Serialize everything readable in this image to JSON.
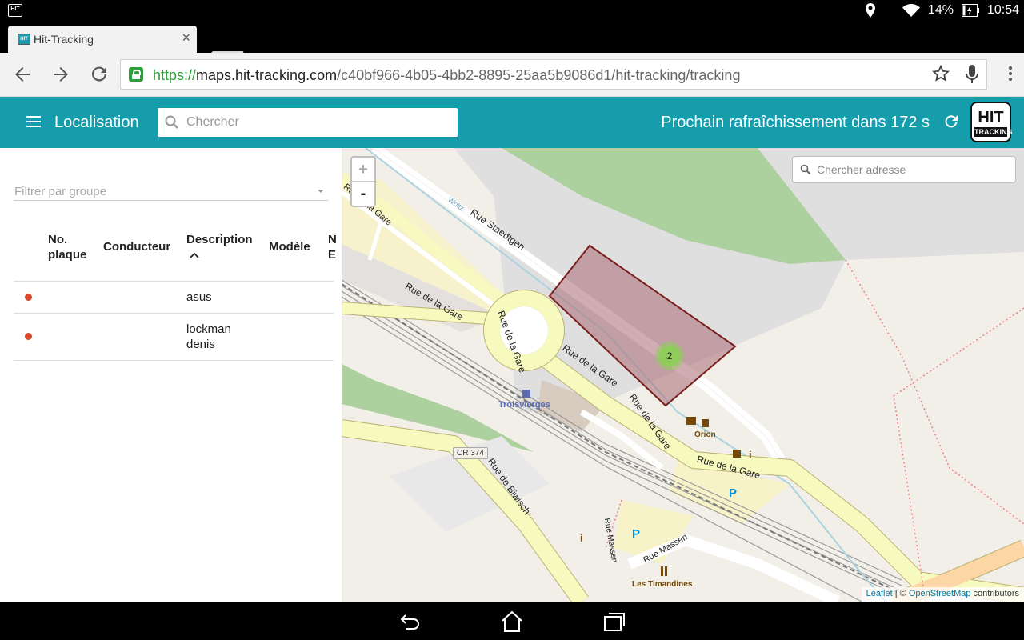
{
  "statusbar": {
    "battery": "14%",
    "time": "10:54",
    "app_icon_text": "HIT"
  },
  "tab": {
    "title": "Hit-Tracking",
    "close": "×"
  },
  "browser": {
    "url_scheme": "https://",
    "url_host": "maps.hit-tracking.com",
    "url_path": "/c40bf966-4b05-4bb2-8895-25aa5b9086d1/hit-tracking/tracking"
  },
  "appbar": {
    "title": "Localisation",
    "search_placeholder": "Chercher",
    "refresh_text": "Prochain rafraîchissement dans 172 s",
    "logo_line1": "HIT",
    "logo_line2": "TRACKING"
  },
  "panel": {
    "filter_placeholder": "Filtrer par groupe",
    "columns": {
      "plate_line1": "No.",
      "plate_line2": "plaque",
      "driver": "Conducteur",
      "description": "Description",
      "model": "Modèle",
      "extra_line1": "N",
      "extra_line2": "E"
    },
    "rows": [
      {
        "description": "asus"
      },
      {
        "description_line1": "lockman",
        "description_line2": "denis"
      }
    ]
  },
  "map": {
    "zoom_in": "+",
    "zoom_out": "-",
    "address_placeholder": "Chercher adresse",
    "cluster_count": "2",
    "labels": {
      "woltz": "Woltz",
      "rue_staedtgen": "Rue Staedtgen",
      "rue_de_la_gare": "Rue de la Gare",
      "rue_de_la_gare_cut": "Rue de la Gare",
      "troisvierges": "Troisvierges",
      "orion": "Orion",
      "cr374": "CR 374",
      "rue_de_biwisch": "Rue de Biwisch",
      "rue_massen": "Rue Massen",
      "les_timandines": "Les Timandines",
      "parking": "P",
      "info": "i"
    },
    "attribution": {
      "leaflet": "Leaflet",
      "sep": " | © ",
      "osm": "OpenStreetMap",
      "contributors": " contributors"
    },
    "colors": {
      "geofence_fill": "#a86a72",
      "geofence_stroke": "#7a1e1e",
      "cluster": "#8fcc5a",
      "park": "#add19e",
      "road": "#f7fabf"
    }
  }
}
